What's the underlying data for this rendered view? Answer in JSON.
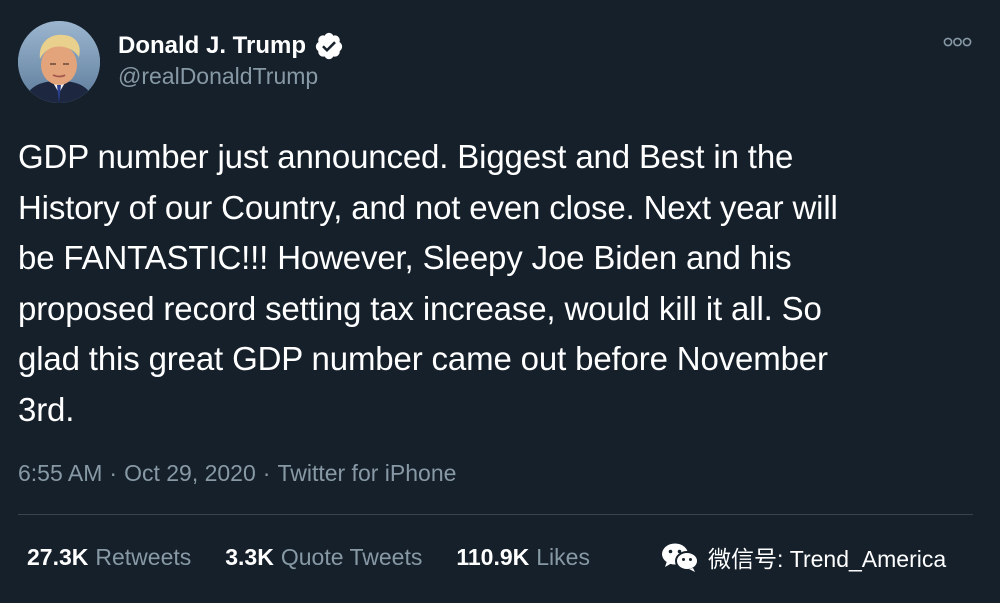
{
  "user": {
    "display_name": "Donald J. Trump",
    "handle": "@realDonaldTrump",
    "avatar_icon": "profile-photo",
    "verified_icon": "verified-badge-icon"
  },
  "tweet": {
    "text_lines": [
      "GDP number just announced. Biggest and Best in the",
      "History of our Country, and not even close. Next year will",
      "be FANTASTIC!!! However, Sleepy Joe Biden and his",
      "proposed record setting tax increase, would kill it all. So",
      "glad this great GDP number came out before November",
      "3rd."
    ],
    "time": "6:55 AM",
    "date": "Oct 29, 2020",
    "source": "Twitter for iPhone",
    "separator": "·"
  },
  "stats": {
    "retweets": {
      "count": "27.3K",
      "label": "Retweets"
    },
    "quote_tweets": {
      "count": "3.3K",
      "label": "Quote Tweets"
    },
    "likes": {
      "count": "110.9K",
      "label": "Likes"
    }
  },
  "watermark": {
    "icon": "wechat-icon",
    "text": "微信号: Trend_America"
  },
  "colors": {
    "background": "#15202b",
    "primary_text": "#ffffff",
    "secondary_text": "#8899a6",
    "divider": "#38444d"
  }
}
